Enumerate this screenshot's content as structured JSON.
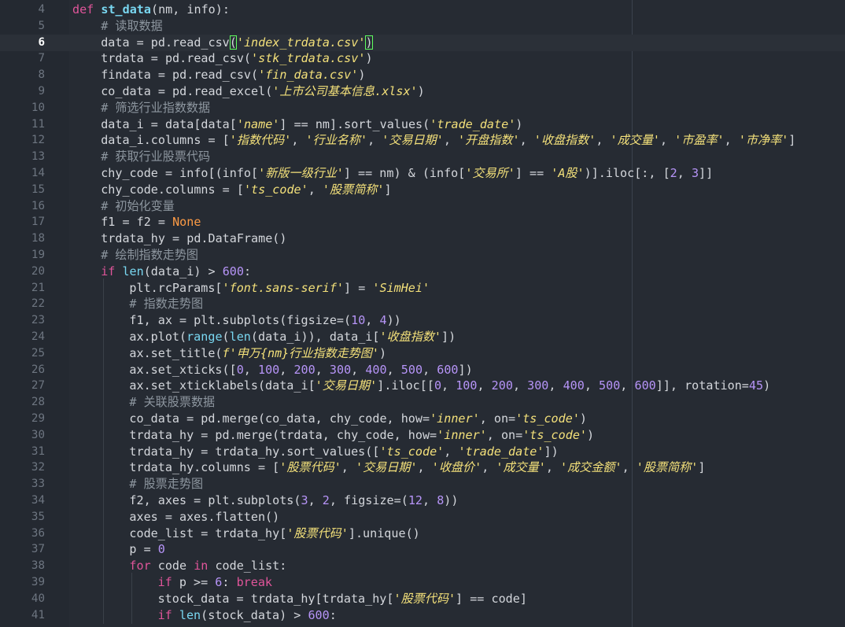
{
  "editor": {
    "active_line": 6,
    "lines": [
      {
        "n": 4,
        "ind": 0,
        "t": [
          [
            "k",
            "def "
          ],
          [
            "f",
            "st_data"
          ],
          [
            "p",
            "(nm, info):"
          ]
        ]
      },
      {
        "n": 5,
        "ind": 1,
        "t": [
          [
            "c",
            "# 读取数据"
          ]
        ]
      },
      {
        "n": 6,
        "ind": 1,
        "t": [
          [
            "p",
            "data = pd.read_csv"
          ],
          [
            "h",
            "("
          ],
          [
            "s",
            "'index_trdata.csv'"
          ],
          [
            "h",
            ")"
          ]
        ]
      },
      {
        "n": 7,
        "ind": 1,
        "t": [
          [
            "p",
            "trdata = pd.read_csv("
          ],
          [
            "s",
            "'stk_trdata.csv'"
          ],
          [
            "p",
            ")"
          ]
        ]
      },
      {
        "n": 8,
        "ind": 1,
        "t": [
          [
            "p",
            "findata = pd.read_csv("
          ],
          [
            "s",
            "'fin_data.csv'"
          ],
          [
            "p",
            ")"
          ]
        ]
      },
      {
        "n": 9,
        "ind": 1,
        "t": [
          [
            "p",
            "co_data = pd.read_excel("
          ],
          [
            "s",
            "'上市公司基本信息.xlsx'"
          ],
          [
            "p",
            ")"
          ]
        ]
      },
      {
        "n": 10,
        "ind": 1,
        "t": [
          [
            "c",
            "# 筛选行业指数数据"
          ]
        ]
      },
      {
        "n": 11,
        "ind": 1,
        "t": [
          [
            "p",
            "data_i = data[data["
          ],
          [
            "s",
            "'name'"
          ],
          [
            "p",
            "] == nm].sort_values("
          ],
          [
            "s",
            "'trade_date'"
          ],
          [
            "p",
            ")"
          ]
        ]
      },
      {
        "n": 12,
        "ind": 1,
        "t": [
          [
            "p",
            "data_i.columns = ["
          ],
          [
            "s",
            "'指数代码'"
          ],
          [
            "p",
            ", "
          ],
          [
            "s",
            "'行业名称'"
          ],
          [
            "p",
            ", "
          ],
          [
            "s",
            "'交易日期'"
          ],
          [
            "p",
            ", "
          ],
          [
            "s",
            "'开盘指数'"
          ],
          [
            "p",
            ", "
          ],
          [
            "s",
            "'收盘指数'"
          ],
          [
            "p",
            ", "
          ],
          [
            "s",
            "'成交量'"
          ],
          [
            "p",
            ", "
          ],
          [
            "s",
            "'市盈率'"
          ],
          [
            "p",
            ", "
          ],
          [
            "s",
            "'市净率'"
          ],
          [
            "p",
            "]"
          ]
        ]
      },
      {
        "n": 13,
        "ind": 1,
        "t": [
          [
            "c",
            "# 获取行业股票代码"
          ]
        ]
      },
      {
        "n": 14,
        "ind": 1,
        "t": [
          [
            "p",
            "chy_code = info[(info["
          ],
          [
            "s",
            "'新版一级行业'"
          ],
          [
            "p",
            "] == nm) & (info["
          ],
          [
            "s",
            "'交易所'"
          ],
          [
            "p",
            "] == "
          ],
          [
            "s",
            "'A股'"
          ],
          [
            "p",
            ")].iloc[:, ["
          ],
          [
            "n",
            "2"
          ],
          [
            "p",
            ", "
          ],
          [
            "n",
            "3"
          ],
          [
            "p",
            "]]"
          ]
        ]
      },
      {
        "n": 15,
        "ind": 1,
        "t": [
          [
            "p",
            "chy_code.columns = ["
          ],
          [
            "s",
            "'ts_code'"
          ],
          [
            "p",
            ", "
          ],
          [
            "s",
            "'股票简称'"
          ],
          [
            "p",
            "]"
          ]
        ]
      },
      {
        "n": 16,
        "ind": 1,
        "t": [
          [
            "c",
            "# 初始化变量"
          ]
        ]
      },
      {
        "n": 17,
        "ind": 1,
        "t": [
          [
            "p",
            "f1 = f2 = "
          ],
          [
            "kw",
            "None"
          ]
        ]
      },
      {
        "n": 18,
        "ind": 1,
        "t": [
          [
            "p",
            "trdata_hy = pd.DataFrame()"
          ]
        ]
      },
      {
        "n": 19,
        "ind": 1,
        "t": [
          [
            "c",
            "# 绘制指数走势图"
          ]
        ]
      },
      {
        "n": 20,
        "ind": 1,
        "t": [
          [
            "k",
            "if "
          ],
          [
            "b",
            "len"
          ],
          [
            "p",
            "(data_i) > "
          ],
          [
            "n",
            "600"
          ],
          [
            "p",
            ":"
          ]
        ]
      },
      {
        "n": 21,
        "ind": 2,
        "t": [
          [
            "p",
            "plt.rcParams["
          ],
          [
            "s",
            "'font.sans-serif'"
          ],
          [
            "p",
            "] = "
          ],
          [
            "s",
            "'SimHei'"
          ]
        ]
      },
      {
        "n": 22,
        "ind": 2,
        "t": [
          [
            "c",
            "# 指数走势图"
          ]
        ]
      },
      {
        "n": 23,
        "ind": 2,
        "t": [
          [
            "p",
            "f1, ax = plt.subplots(figsize=("
          ],
          [
            "n",
            "10"
          ],
          [
            "p",
            ", "
          ],
          [
            "n",
            "4"
          ],
          [
            "p",
            "))"
          ]
        ]
      },
      {
        "n": 24,
        "ind": 2,
        "t": [
          [
            "p",
            "ax.plot("
          ],
          [
            "b",
            "range"
          ],
          [
            "p",
            "("
          ],
          [
            "b",
            "len"
          ],
          [
            "p",
            "(data_i)), data_i["
          ],
          [
            "s",
            "'收盘指数'"
          ],
          [
            "p",
            "])"
          ]
        ]
      },
      {
        "n": 25,
        "ind": 2,
        "t": [
          [
            "p",
            "ax.set_title("
          ],
          [
            "s",
            "f'申万{nm}行业指数走势图'"
          ],
          [
            "p",
            ")"
          ]
        ]
      },
      {
        "n": 26,
        "ind": 2,
        "t": [
          [
            "p",
            "ax.set_xticks(["
          ],
          [
            "n",
            "0"
          ],
          [
            "p",
            ", "
          ],
          [
            "n",
            "100"
          ],
          [
            "p",
            ", "
          ],
          [
            "n",
            "200"
          ],
          [
            "p",
            ", "
          ],
          [
            "n",
            "300"
          ],
          [
            "p",
            ", "
          ],
          [
            "n",
            "400"
          ],
          [
            "p",
            ", "
          ],
          [
            "n",
            "500"
          ],
          [
            "p",
            ", "
          ],
          [
            "n",
            "600"
          ],
          [
            "p",
            "])"
          ]
        ]
      },
      {
        "n": 27,
        "ind": 2,
        "t": [
          [
            "p",
            "ax.set_xticklabels(data_i["
          ],
          [
            "s",
            "'交易日期'"
          ],
          [
            "p",
            "].iloc[["
          ],
          [
            "n",
            "0"
          ],
          [
            "p",
            ", "
          ],
          [
            "n",
            "100"
          ],
          [
            "p",
            ", "
          ],
          [
            "n",
            "200"
          ],
          [
            "p",
            ", "
          ],
          [
            "n",
            "300"
          ],
          [
            "p",
            ", "
          ],
          [
            "n",
            "400"
          ],
          [
            "p",
            ", "
          ],
          [
            "n",
            "500"
          ],
          [
            "p",
            ", "
          ],
          [
            "n",
            "600"
          ],
          [
            "p",
            "]], rotation="
          ],
          [
            "n",
            "45"
          ],
          [
            "p",
            ")"
          ]
        ]
      },
      {
        "n": 28,
        "ind": 2,
        "t": [
          [
            "c",
            "# 关联股票数据"
          ]
        ]
      },
      {
        "n": 29,
        "ind": 2,
        "t": [
          [
            "p",
            "co_data = pd.merge(co_data, chy_code, how="
          ],
          [
            "s",
            "'inner'"
          ],
          [
            "p",
            ", on="
          ],
          [
            "s",
            "'ts_code'"
          ],
          [
            "p",
            ")"
          ]
        ]
      },
      {
        "n": 30,
        "ind": 2,
        "t": [
          [
            "p",
            "trdata_hy = pd.merge(trdata, chy_code, how="
          ],
          [
            "s",
            "'inner'"
          ],
          [
            "p",
            ", on="
          ],
          [
            "s",
            "'ts_code'"
          ],
          [
            "p",
            ")"
          ]
        ]
      },
      {
        "n": 31,
        "ind": 2,
        "t": [
          [
            "p",
            "trdata_hy = trdata_hy.sort_values(["
          ],
          [
            "s",
            "'ts_code'"
          ],
          [
            "p",
            ", "
          ],
          [
            "s",
            "'trade_date'"
          ],
          [
            "p",
            "])"
          ]
        ]
      },
      {
        "n": 32,
        "ind": 2,
        "t": [
          [
            "p",
            "trdata_hy.columns = ["
          ],
          [
            "s",
            "'股票代码'"
          ],
          [
            "p",
            ", "
          ],
          [
            "s",
            "'交易日期'"
          ],
          [
            "p",
            ", "
          ],
          [
            "s",
            "'收盘价'"
          ],
          [
            "p",
            ", "
          ],
          [
            "s",
            "'成交量'"
          ],
          [
            "p",
            ", "
          ],
          [
            "s",
            "'成交金额'"
          ],
          [
            "p",
            ", "
          ],
          [
            "s",
            "'股票简称'"
          ],
          [
            "p",
            "]"
          ]
        ]
      },
      {
        "n": 33,
        "ind": 2,
        "t": [
          [
            "c",
            "# 股票走势图"
          ]
        ]
      },
      {
        "n": 34,
        "ind": 2,
        "t": [
          [
            "p",
            "f2, axes = plt.subplots("
          ],
          [
            "n",
            "3"
          ],
          [
            "p",
            ", "
          ],
          [
            "n",
            "2"
          ],
          [
            "p",
            ", figsize=("
          ],
          [
            "n",
            "12"
          ],
          [
            "p",
            ", "
          ],
          [
            "n",
            "8"
          ],
          [
            "p",
            "))"
          ]
        ]
      },
      {
        "n": 35,
        "ind": 2,
        "t": [
          [
            "p",
            "axes = axes.flatten()"
          ]
        ]
      },
      {
        "n": 36,
        "ind": 2,
        "t": [
          [
            "p",
            "code_list = trdata_hy["
          ],
          [
            "s",
            "'股票代码'"
          ],
          [
            "p",
            "].unique()"
          ]
        ]
      },
      {
        "n": 37,
        "ind": 2,
        "t": [
          [
            "p",
            "p = "
          ],
          [
            "n",
            "0"
          ]
        ]
      },
      {
        "n": 38,
        "ind": 2,
        "t": [
          [
            "k",
            "for "
          ],
          [
            "p",
            "code "
          ],
          [
            "k",
            "in "
          ],
          [
            "p",
            "code_list:"
          ]
        ]
      },
      {
        "n": 39,
        "ind": 3,
        "t": [
          [
            "k",
            "if "
          ],
          [
            "p",
            "p >= "
          ],
          [
            "n",
            "6"
          ],
          [
            "p",
            ": "
          ],
          [
            "k",
            "break"
          ]
        ]
      },
      {
        "n": 40,
        "ind": 3,
        "t": [
          [
            "p",
            "stock_data = trdata_hy[trdata_hy["
          ],
          [
            "s",
            "'股票代码'"
          ],
          [
            "p",
            "] == code]"
          ]
        ]
      },
      {
        "n": 41,
        "ind": 3,
        "t": [
          [
            "k",
            "if "
          ],
          [
            "b",
            "len"
          ],
          [
            "p",
            "(stock_data) > "
          ],
          [
            "n",
            "600"
          ],
          [
            "p",
            ":"
          ]
        ]
      }
    ]
  },
  "colors": {
    "background": "#262b33",
    "keyword": "#e0559a",
    "function": "#79d7f1",
    "string": "#f3e07a",
    "number": "#b694f7",
    "comment": "#8d969f",
    "constant": "#fd9b45"
  }
}
